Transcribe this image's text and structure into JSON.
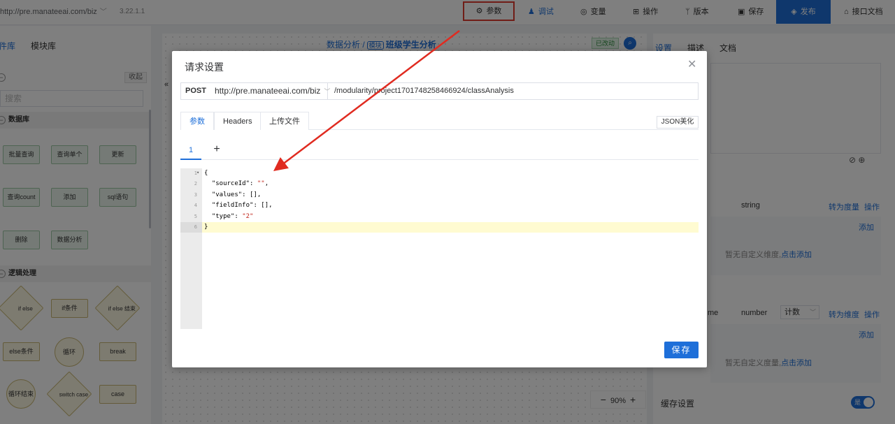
{
  "topbar": {
    "url": "http://pre.manateeai.com/biz",
    "version": "3.22.1.1",
    "params": "参数",
    "debug": "调试",
    "variables": "变量",
    "operations": "操作",
    "versions": "版本",
    "save": "保存",
    "publish": "发布",
    "api_docs": "接口文档"
  },
  "left_panel": {
    "tab_components": "件库",
    "tab_modules": "模块库",
    "collapse": "收起",
    "search_placeholder": "搜索",
    "section_database": "数据库",
    "db_nodes": [
      "批量查询",
      "查询单个",
      "更新",
      "查询count",
      "添加",
      "sql语句",
      "删除",
      "数据分析"
    ],
    "section_logic": "逻辑处理",
    "logic_nodes": [
      "if else",
      "if条件",
      "if else 结束",
      "else条件",
      "循环",
      "break",
      "循环结束",
      "switch case",
      "case"
    ]
  },
  "canvas": {
    "breadcrumb": "数据分析 /",
    "module_tag": "模块",
    "title": "班级学生分析",
    "changed": "已改动",
    "zoom": "90%"
  },
  "right_panel": {
    "tabs": [
      "设置",
      "描述",
      "文档"
    ],
    "type_string": "string",
    "to_measure": "转为度量",
    "operation": "操作",
    "add": "添加",
    "empty_dimension": "暂无自定义维度,",
    "click_add": "点击添加",
    "field_name_tail": "me",
    "type_number": "number",
    "agg_select": "计数",
    "to_dimension": "转为维度",
    "empty_measure": "暂无自定义度量,",
    "cache_label": "缓存设置",
    "switch_on": "是"
  },
  "modal": {
    "title": "请求设置",
    "method": "POST",
    "host": "http://pre.manateeai.com/biz",
    "path": "/modularity/project1701748258466924/classAnalysis",
    "tabs": [
      "参数",
      "Headers",
      "上传文件"
    ],
    "json_beautify": "JSON美化",
    "subtab": "1",
    "add_tab": "+",
    "code_lines": [
      "{",
      "  \"sourceId\": \"\",",
      "  \"values\": [],",
      "  \"fieldInfo\": [],",
      "  \"type\": \"2\"",
      "}"
    ],
    "line_numbers": [
      "1",
      "2",
      "3",
      "4",
      "5",
      "6"
    ],
    "save": "保存"
  },
  "colors": {
    "accent": "#1e6fd9",
    "highlight_box": "#e13b2f",
    "arrow": "#e02b20"
  }
}
